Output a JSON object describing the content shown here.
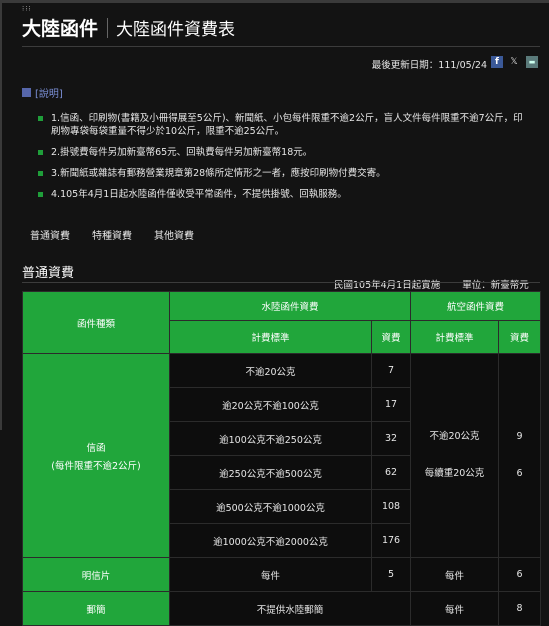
{
  "header": {
    "menu_glyph": "⁝⁝⁝",
    "title_main": "大陸函件",
    "title_sub": "大陸函件資費表"
  },
  "update": {
    "label": "最後更新日期：",
    "date": "111/05/24"
  },
  "share_icons": [
    "facebook-icon",
    "x-twitter-icon",
    "line-icon"
  ],
  "notes": {
    "title": "[說明]",
    "items": [
      "1.信函、印刷物(書籍及小冊得展至5公斤)、新聞紙、小包每件限重不逾2公斤，盲人文件每件限重不逾7公斤，印刷物專袋每袋重量不得少於10公斤，限重不逾25公斤。",
      "2.掛號費每件另加新臺幣65元、回執費每件另加新臺幣18元。",
      "3.新聞紙或雜誌有郵務營業規章第28條所定情形之一者，應按印刷物付費交寄。",
      "4.105年4月1日起水陸函件僅收受平常函件，不提供掛號、回執服務。"
    ]
  },
  "tabs": [
    "普通資費",
    "特種資費",
    "其他資費"
  ],
  "section": {
    "title": "普通資費",
    "effective": "民國105年4月1日起實施",
    "unit": "單位：新臺幣元"
  },
  "table": {
    "h_type": "函件種類",
    "h_surface": "水陸函件資費",
    "h_air": "航空函件資費",
    "h_std": "計費標準",
    "h_fee": "資費",
    "h_std2": "計費標準",
    "h_fee2": "資費",
    "letter_type": "信函",
    "letter_note": "(每件限重不逾2公斤)",
    "surface_rows": [
      {
        "std": "不逾20公克",
        "fee": "7"
      },
      {
        "std": "逾20公克不逾100公克",
        "fee": "17"
      },
      {
        "std": "逾100公克不逾250公克",
        "fee": "32"
      },
      {
        "std": "逾250公克不逾500公克",
        "fee": "62"
      },
      {
        "std": "逾500公克不逾1000公克",
        "fee": "108"
      },
      {
        "std": "逾1000公克不逾2000公克",
        "fee": "176"
      }
    ],
    "air_std_1": "不逾20公克",
    "air_std_2": "每續重20公克",
    "air_fee_1": "9",
    "air_fee_2": "6",
    "postcard": {
      "type": "明信片",
      "std": "每件",
      "fee": "5",
      "air_std": "每件",
      "air_fee": "6"
    },
    "aerogramme": {
      "type": "郵簡",
      "std": "不提供水陸郵簡",
      "air_std": "每件",
      "air_fee": "8"
    }
  }
}
